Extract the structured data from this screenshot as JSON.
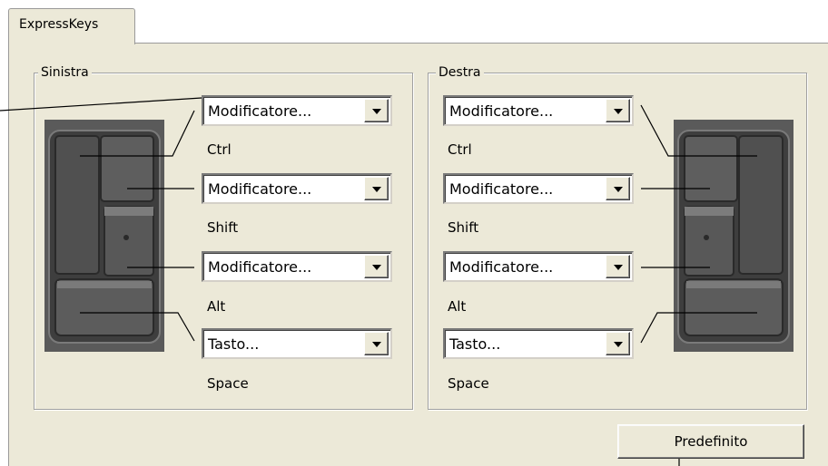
{
  "tabs": [
    {
      "label": "ExpressKeys"
    }
  ],
  "left": {
    "title": "Sinistra",
    "keys": [
      {
        "value": "Modificatore...",
        "caption": "Ctrl"
      },
      {
        "value": "Modificatore...",
        "caption": "Shift"
      },
      {
        "value": "Modificatore...",
        "caption": "Alt"
      },
      {
        "value": "Tasto...",
        "caption": "Space"
      }
    ]
  },
  "right": {
    "title": "Destra",
    "keys": [
      {
        "value": "Modificatore...",
        "caption": "Ctrl"
      },
      {
        "value": "Modificatore...",
        "caption": "Shift"
      },
      {
        "value": "Modificatore...",
        "caption": "Alt"
      },
      {
        "value": "Tasto...",
        "caption": "Space"
      }
    ]
  },
  "buttons": {
    "default_label": "Predefinito"
  },
  "icons": {
    "dropdown": "chevron-down-icon",
    "keypad": "expresskeys-keypad-icon"
  },
  "colors": {
    "panel_bg": "#ece9d8",
    "keypad_dark": "#555555",
    "keypad_light": "#6a6a6a"
  }
}
